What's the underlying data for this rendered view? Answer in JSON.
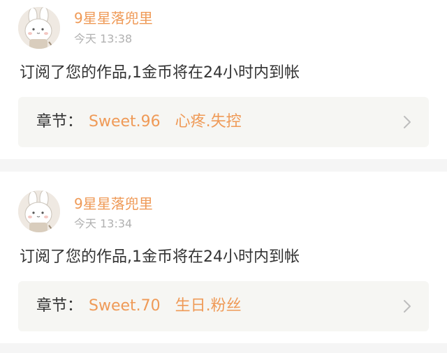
{
  "notifications": [
    {
      "username": "9星星落兜里",
      "timestamp": "今天 13:38",
      "message": "订阅了您的作品,1金币将在24小时内到帐",
      "chapter_label": "章节：",
      "chapter_title": "Sweet.96   心疼.失控"
    },
    {
      "username": "9星星落兜里",
      "timestamp": "今天 13:34",
      "message": "订阅了您的作品,1金币将在24小时内到帐",
      "chapter_label": "章节：",
      "chapter_title": "Sweet.70   生日.粉丝"
    }
  ],
  "icons": {
    "avatar": "bunny-avatar-icon",
    "chevron": "chevron-right-icon"
  },
  "colors": {
    "accent": "#ef9a57",
    "text": "#333333",
    "muted": "#b1b1b1",
    "chapter_bg": "#f6f6f3",
    "separator": "#f5f5f5"
  }
}
